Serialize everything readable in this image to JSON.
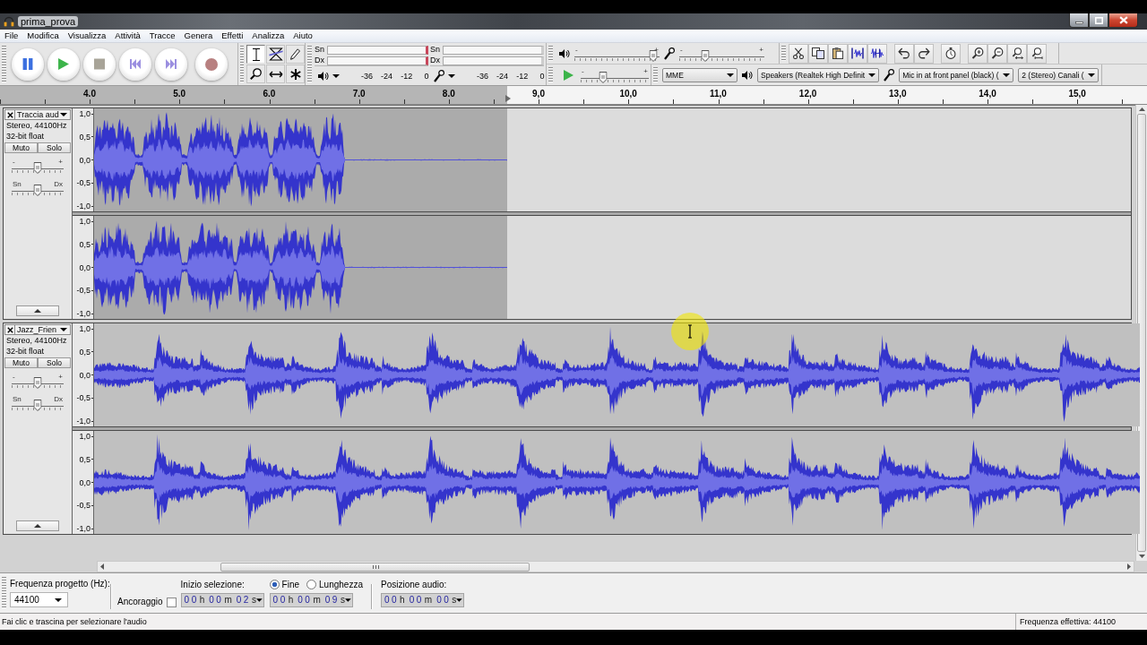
{
  "window": {
    "title": "prima_prova"
  },
  "menu": [
    "File",
    "Modifica",
    "Visualizza",
    "Attività",
    "Tracce",
    "Genera",
    "Effetti",
    "Analizza",
    "Aiuto"
  ],
  "tools": [
    {
      "kind": "select",
      "selected": true
    },
    {
      "kind": "envelope",
      "selected": false
    },
    {
      "kind": "draw",
      "selected": false
    },
    {
      "kind": "zoom",
      "selected": false
    },
    {
      "kind": "time-shift",
      "selected": false
    },
    {
      "kind": "multi",
      "selected": false
    }
  ],
  "meters": [
    {
      "kind": "playback",
      "clipped": true,
      "channels": [
        "Sn",
        "Dx"
      ],
      "scale": [
        "-36",
        "-24",
        "-12",
        "0"
      ]
    },
    {
      "kind": "recording",
      "clipped": false,
      "channels": [
        "Sn",
        "Dx"
      ],
      "scale": [
        "-36",
        "-24",
        "-12",
        "0"
      ]
    }
  ],
  "mixer": [
    {
      "kind": "output",
      "min_label": "-",
      "max_label": "+",
      "level": 0.93
    },
    {
      "kind": "input",
      "min_label": "-",
      "max_label": "+",
      "level": 0.3
    }
  ],
  "play_at_speed": {
    "min_label": "-",
    "max_label": "+",
    "level": 0.33
  },
  "devices": [
    {
      "kind": "host",
      "value": "MME"
    },
    {
      "kind": "output",
      "value": "Speakers (Realtek High Definit"
    },
    {
      "kind": "input",
      "value": "Mic in at front panel (black) ("
    },
    {
      "kind": "channels",
      "value": "2 (Stereo) Canali ("
    }
  ],
  "ruler": [
    "4.0",
    "5.0",
    "6.0",
    "7.0",
    "8.0",
    "9,0",
    "10,0",
    "11,0",
    "12,0",
    "13,0",
    "14,0",
    "15,0"
  ],
  "tracks": [
    {
      "name": "Traccia aud",
      "kind": "voice",
      "format": "Stereo, 44100Hz",
      "sample_format": "32-bit float",
      "mute": {
        "label": "Muto",
        "on": false
      },
      "solo": {
        "label": "Solo",
        "on": false
      },
      "gain": {
        "min_label": "-",
        "max_label": "+",
        "level": 0.5
      },
      "pan": {
        "min_label": "Sn",
        "max_label": "Dx",
        "level": 0.5
      },
      "channels": [
        {
          "scale": [
            "1,0",
            "0,5",
            "0,0",
            "-0,5",
            "-1,0"
          ]
        },
        {
          "scale": [
            "1,0",
            "0,5",
            "0,0",
            "-0,5",
            "-1,0"
          ]
        }
      ]
    },
    {
      "name": "Jazz_Frien",
      "kind": "music",
      "format": "Stereo, 44100Hz",
      "sample_format": "32-bit float",
      "mute": {
        "label": "Muto",
        "on": false
      },
      "solo": {
        "label": "Solo",
        "on": false
      },
      "gain": {
        "min_label": "-",
        "max_label": "+",
        "level": 0.5
      },
      "pan": {
        "min_label": "Sn",
        "max_label": "Dx",
        "level": 0.5
      },
      "channels": [
        {
          "scale": [
            "1,0",
            "0,5",
            "0,0",
            "-0,5",
            "-1,0"
          ]
        },
        {
          "scale": [
            "1,0",
            "0,5",
            "0,0",
            "-0,5",
            "-1,0"
          ]
        }
      ]
    }
  ],
  "selection_toolbar": {
    "rate_label": "Frequenza progetto (Hz):",
    "rate": "44100",
    "snap_label": "Ancoraggio",
    "snap": false,
    "start_label": "Inizio selezione:",
    "start": [
      {
        "value": "00",
        "unit": "h"
      },
      {
        "value": "00",
        "unit": "m"
      },
      {
        "value": "02",
        "unit": "s"
      }
    ],
    "end_modes": [
      {
        "label": "Fine",
        "selected": true
      },
      {
        "label": "Lunghezza",
        "selected": false
      }
    ],
    "end": [
      {
        "value": "00",
        "unit": "h"
      },
      {
        "value": "00",
        "unit": "m"
      },
      {
        "value": "09",
        "unit": "s"
      }
    ],
    "position_label": "Posizione audio:",
    "position": [
      {
        "value": "00",
        "unit": "h"
      },
      {
        "value": "00",
        "unit": "m"
      },
      {
        "value": "00",
        "unit": "s"
      }
    ]
  },
  "status_bar": {
    "hint": "Fai clic e trascina per selezionare l'audio",
    "rate": "Frequenza effettiva: 44100"
  }
}
